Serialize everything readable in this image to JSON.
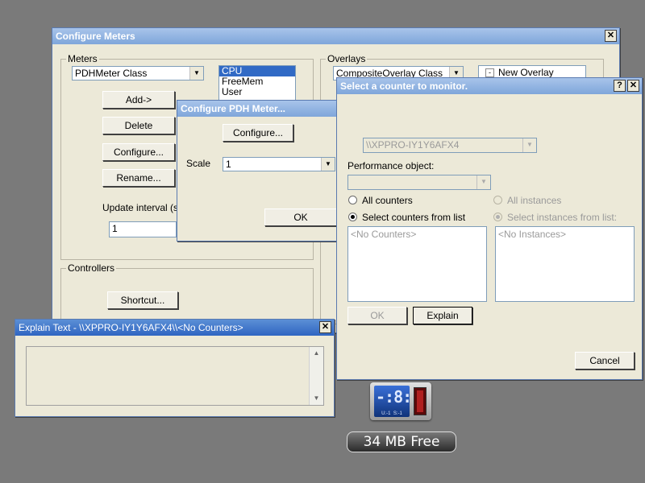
{
  "configure_meters": {
    "title": "Configure Meters",
    "meters_group": "Meters",
    "meter_class": "PDHMeter Class",
    "meter_list": [
      "CPU",
      "FreeMem",
      "User"
    ],
    "add_label": "Add->",
    "delete_label": "Delete",
    "configure_label": "Configure...",
    "rename_label": "Rename...",
    "update_interval_label": "Update interval (sec",
    "update_interval_value": "1",
    "overlays_group": "Overlays",
    "overlay_class": "CompositeOverlay Class",
    "overlay_tree_item": "New Overlay",
    "controllers_group": "Controllers",
    "shortcut_label": "Shortcut..."
  },
  "pdh_meter": {
    "title": "Configure PDH Meter...",
    "configure_label": "Configure...",
    "scale_label": "Scale",
    "scale_value": "1",
    "ok_label": "OK"
  },
  "counter_dialog": {
    "title": "Select a counter to monitor.",
    "help_glyph": "?",
    "machine": "\\\\XPPRO-IY1Y6AFX4",
    "perf_object_label": "Performance object:",
    "all_counters": "All counters",
    "select_counters": "Select counters from list",
    "all_instances": "All instances",
    "select_instances": "Select instances from list:",
    "no_counters": "<No Counters>",
    "no_instances": "<No Instances>",
    "ok_label": "OK",
    "explain_label": "Explain",
    "cancel_label": "Cancel"
  },
  "explain_text": {
    "title": "Explain Text - \\\\XPPRO-IY1Y6AFX4\\\\<No Counters>"
  },
  "widgets": {
    "cpu_meter_digits": "-:8:",
    "cpu_meter_sub": "U:-1  S:-1",
    "mem_free": "34 MB Free"
  },
  "icons": {
    "close": "close-icon",
    "help": "help-icon",
    "dropdown": "chevron-down-icon",
    "tree_collapse": "minus-box-icon"
  }
}
